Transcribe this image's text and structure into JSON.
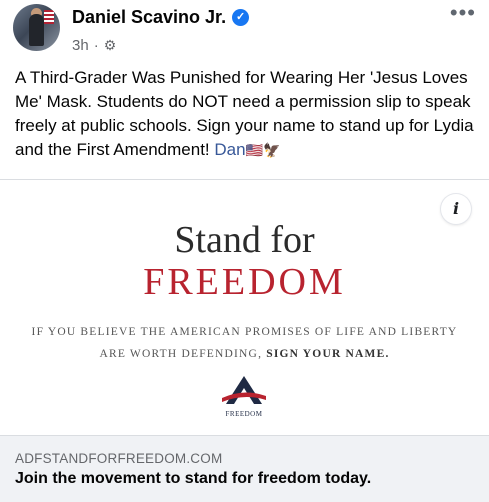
{
  "post": {
    "author": "Daniel Scavino Jr.",
    "time": "3h",
    "separator": "·",
    "text": "A Third-Grader Was Punished for Wearing Her 'Jesus Loves Me' Mask. Students do NOT need a permission slip to speak freely at public schools. Sign your name to stand up for Lydia and the First Amendment!",
    "signature_link": "Dan",
    "signature_emoji": "🇺🇸🦅"
  },
  "ad": {
    "headline_line1": "Stand for",
    "headline_line2": "FREEDOM",
    "tagline_part1": "IF YOU BELIEVE THE AMERICAN PROMISES OF LIFE AND LIBERTY ARE WORTH DEFENDING, ",
    "tagline_part2": "SIGN YOUR NAME.",
    "logo_text": "FREEDOM",
    "info_label": "i"
  },
  "link_preview": {
    "domain": "ADFSTANDFORFREEDOM.COM",
    "title": "Join the movement to stand for freedom today."
  },
  "colors": {
    "verified": "#1877f2",
    "freedom_red": "#b8232f",
    "link": "#385898"
  }
}
